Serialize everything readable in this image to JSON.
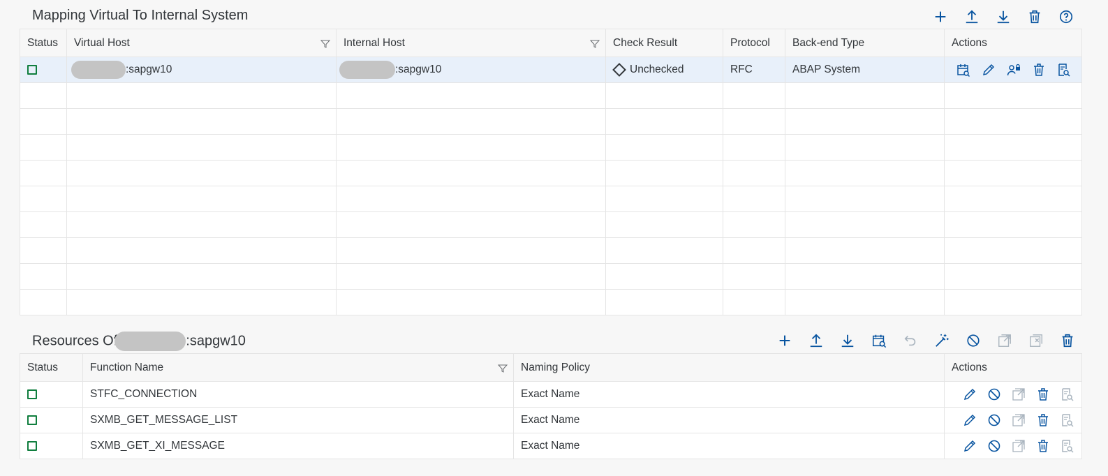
{
  "mapping": {
    "title": "Mapping Virtual To Internal System",
    "toolbar": [
      {
        "name": "add-icon",
        "label": "Add"
      },
      {
        "name": "upload-icon",
        "label": "Upload"
      },
      {
        "name": "download-icon",
        "label": "Download"
      },
      {
        "name": "delete-icon",
        "label": "Delete"
      },
      {
        "name": "help-icon",
        "label": "Help"
      }
    ],
    "columns": [
      "Status",
      "Virtual Host",
      "Internal Host",
      "Check Result",
      "Protocol",
      "Back-end Type",
      "Actions"
    ],
    "row": {
      "virtual_host_suffix": ":sapgw10",
      "internal_host_suffix": ":sapgw10",
      "check_result": "Unchecked",
      "protocol": "RFC",
      "backend_type": "ABAP System"
    }
  },
  "resources": {
    "title_prefix": "Resources Of",
    "title_suffix": ":sapgw10",
    "columns": [
      "Status",
      "Function Name",
      "Naming Policy",
      "Actions"
    ],
    "rows": [
      {
        "function_name": "STFC_CONNECTION",
        "naming_policy": "Exact Name"
      },
      {
        "function_name": "SXMB_GET_MESSAGE_LIST",
        "naming_policy": "Exact Name"
      },
      {
        "function_name": "SXMB_GET_XI_MESSAGE",
        "naming_policy": "Exact Name"
      }
    ]
  },
  "colors": {
    "accent": "#0a6ed1",
    "icon": "#0854a0",
    "status_green": "#107e3e",
    "selected_row": "#e8f0fa",
    "disabled_icon": "#a9b4be"
  }
}
